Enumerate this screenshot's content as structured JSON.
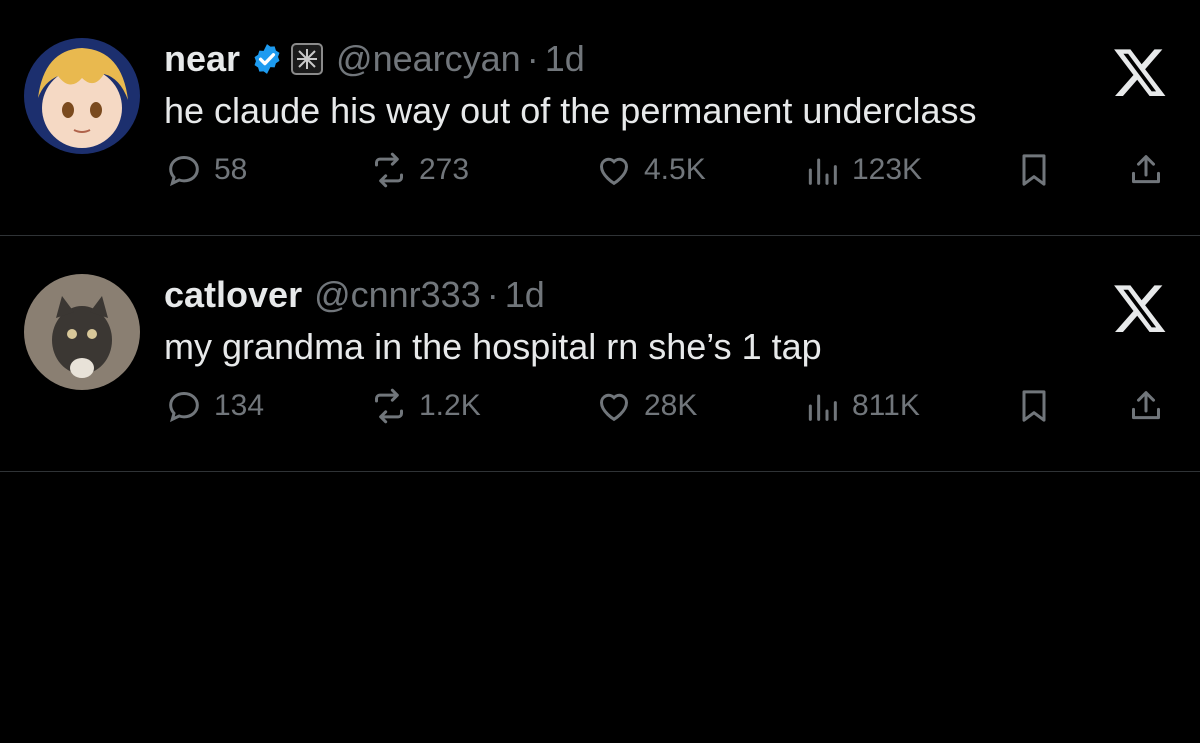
{
  "posts": [
    {
      "display_name": "near",
      "verified": true,
      "handle": "@nearcyan",
      "separator": "·",
      "time": "1d",
      "text": "he claude his way out of the permanent underclass",
      "stats": {
        "replies": "58",
        "reposts": "273",
        "likes": "4.5K",
        "views": "123K"
      },
      "avatar_icon": "anime-girl-avatar"
    },
    {
      "display_name": "catlover",
      "verified": false,
      "handle": "@cnnr333",
      "separator": "·",
      "time": "1d",
      "text": "my grandma in the hospital rn she’s 1 tap",
      "stats": {
        "replies": "134",
        "reposts": "1.2K",
        "likes": "28K",
        "views": "811K"
      },
      "avatar_icon": "kitten-avatar"
    }
  ],
  "colors": {
    "background": "#000000",
    "text": "#e7e9ea",
    "muted": "#71767b",
    "verified": "#1d9bf0",
    "divider": "#2f3336"
  }
}
